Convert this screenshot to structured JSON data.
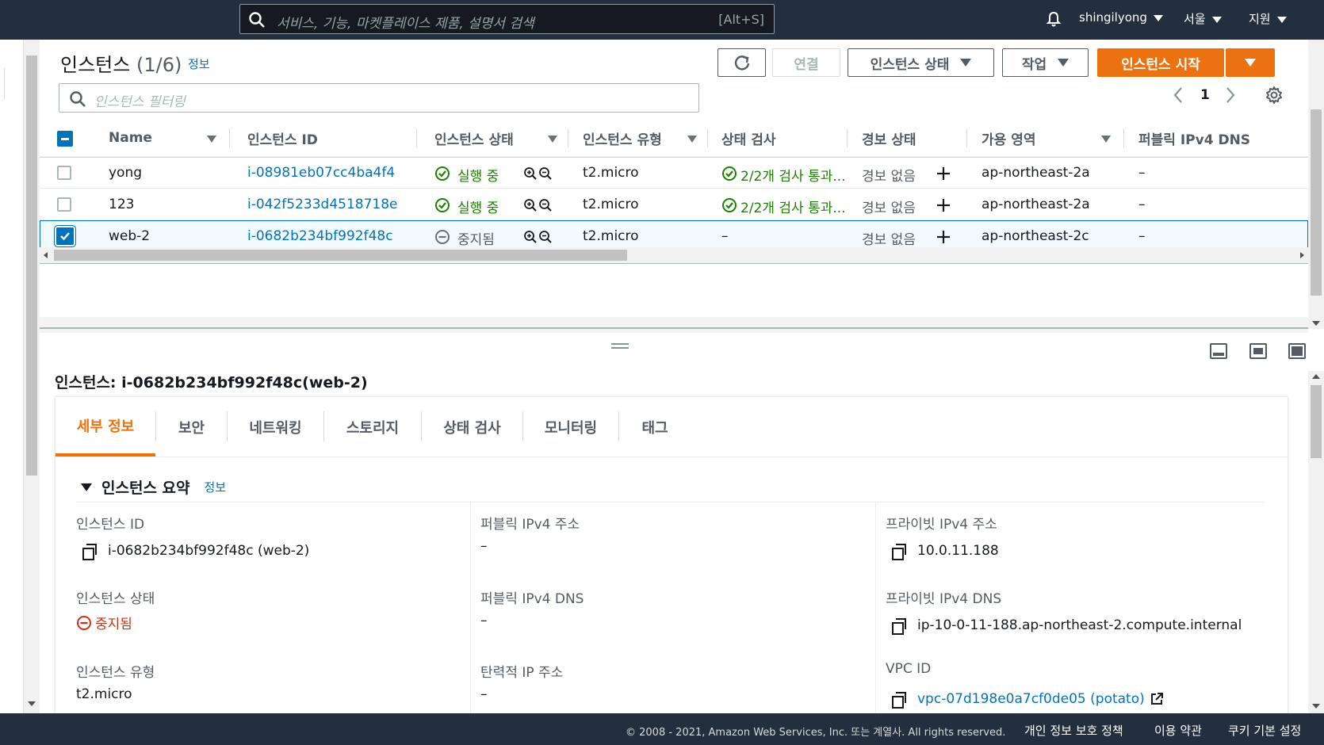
{
  "topnav": {
    "search_placeholder": "서비스, 기능, 마켓플레이스 제품, 설명서 검색",
    "search_shortcut": "[Alt+S]",
    "user": "shingilyong",
    "region": "서울",
    "support": "지원"
  },
  "instances": {
    "title": "인스턴스",
    "count": "(1/6)",
    "info": "정보",
    "filter_placeholder": "인스턴스 필터링",
    "buttons": {
      "connect": "연결",
      "instance_state": "인스턴스 상태",
      "actions": "작업",
      "launch": "인스턴스 시작"
    },
    "page": "1",
    "columns": [
      "Name",
      "인스턴스 ID",
      "인스턴스 상태",
      "인스턴스 유형",
      "상태 검사",
      "경보 상태",
      "가용 영역",
      "퍼블릭 IPv4 DNS"
    ],
    "rows": [
      {
        "name": "yong",
        "id": "i-08981eb07cc4ba4f4",
        "state": "실행 중",
        "type": "t2.micro",
        "check": "2/2개 검사 통과...",
        "alarm": "경보 없음",
        "az": "ap-northeast-2a",
        "dns": "–"
      },
      {
        "name": "123",
        "id": "i-042f5233d4518718e",
        "state": "실행 중",
        "type": "t2.micro",
        "check": "2/2개 검사 통과...",
        "alarm": "경보 없음",
        "az": "ap-northeast-2a",
        "dns": "–"
      },
      {
        "name": "web-2",
        "id": "i-0682b234bf992f48c",
        "state": "중지됨",
        "type": "t2.micro",
        "check": "–",
        "alarm": "경보 없음",
        "az": "ap-northeast-2c",
        "dns": "–"
      }
    ]
  },
  "detail": {
    "title": "인스턴스: i-0682b234bf992f48c(web-2)",
    "tabs": [
      "세부 정보",
      "보안",
      "네트워킹",
      "스토리지",
      "상태 검사",
      "모니터링",
      "태그"
    ],
    "summary_title": "인스턴스 요약",
    "summary_info": "정보",
    "fields": {
      "instance_id_label": "인스턴스 ID",
      "instance_id_value": "i-0682b234bf992f48c (web-2)",
      "instance_state_label": "인스턴스 상태",
      "instance_state_value": "중지됨",
      "instance_type_label": "인스턴스 유형",
      "instance_type_value": "t2.micro",
      "public_ip_label": "퍼블릭 IPv4 주소",
      "public_ip_value": "–",
      "public_dns_label": "퍼블릭 IPv4 DNS",
      "public_dns_value": "–",
      "elastic_ip_label": "탄력적 IP 주소",
      "elastic_ip_value": "–",
      "private_ip_label": "프라이빗 IPv4 주소",
      "private_ip_value": "10.0.11.188",
      "private_dns_label": "프라이빗 IPv4 DNS",
      "private_dns_value": "ip-10-0-11-188.ap-northeast-2.compute.internal",
      "vpc_label": "VPC ID",
      "vpc_value": "vpc-07d198e0a7cf0de05 (potato)"
    }
  },
  "footer": {
    "copyright": "© 2008 - 2021, Amazon Web Services, Inc. 또는 계열사. All rights reserved.",
    "privacy": "개인 정보 보호 정책",
    "terms": "이용 약관",
    "cookies": "쿠키 기본 설정"
  },
  "colors": {
    "nav_bg": "#232f3e",
    "accent": "#ec7211",
    "link": "#0073bb",
    "success": "#1d8102",
    "stopped": "#d13212"
  }
}
